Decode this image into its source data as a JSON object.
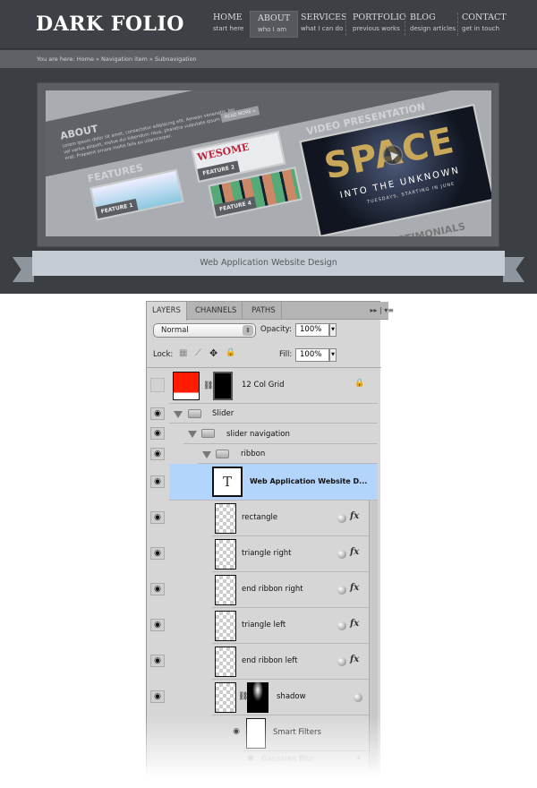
{
  "site": {
    "logo": "DARK FOLIO",
    "nav": [
      {
        "title": "HOME",
        "sub": "start here",
        "active": false
      },
      {
        "title": "ABOUT",
        "sub": "who I am",
        "active": true
      },
      {
        "title": "SERVICES",
        "sub": "what I can do",
        "active": false
      },
      {
        "title": "PORTFOLIO",
        "sub": "previous works",
        "active": false
      },
      {
        "title": "BLOG",
        "sub": "design articles",
        "active": false
      },
      {
        "title": "CONTACT",
        "sub": "get in touch",
        "active": false
      }
    ],
    "breadcrumb": "You are here: Home » Navigation item » Subnavigation",
    "hero": {
      "about_heading": "ABOUT",
      "about_text": "Lorem ipsum dolor sit amet, consectetur adipiscing elit. Aenean venenatis, leo vel varius aliquet, metus dui bibendum risus, pharetra vulputate ipsum orci at erat. Praesent ornare mollis felis eu ullamcorper.",
      "read_more": "READ MORE »",
      "features_heading": "FEATURES",
      "feature1": "FEATURE 1",
      "feature2": "FEATURE 2",
      "feature4": "FEATURE 4",
      "wesome": "WESOME",
      "video_heading": "VIDEO PRESENTATION",
      "video_title": "SPACE",
      "video_sub": "INTO THE UNKNOWN",
      "video_sub2": "TUESDAYS, STARTING IN JUNE",
      "testimonials": "TESTIMONIALS"
    },
    "ribbon": "Web Application Website Design"
  },
  "panel": {
    "tabs": [
      "LAYERS",
      "CHANNELS",
      "PATHS"
    ],
    "active_tab": "LAYERS",
    "blend_mode": "Normal",
    "opacity_label": "Opacity:",
    "opacity": "100%",
    "lock_label": "Lock:",
    "fill_label": "Fill:",
    "fill": "100%",
    "layers": [
      {
        "name": "12 Col Grid",
        "visible": false,
        "locked": true
      },
      {
        "name": "Slider",
        "type": "group",
        "visible": true
      },
      {
        "name": "slider navigation",
        "type": "group",
        "visible": true
      },
      {
        "name": "ribbon",
        "type": "group",
        "visible": true
      },
      {
        "name": "Web Application Website D...",
        "type": "text",
        "visible": true,
        "selected": true
      },
      {
        "name": "rectangle",
        "visible": true,
        "fx": true
      },
      {
        "name": "triangle right",
        "visible": true,
        "fx": true
      },
      {
        "name": "end ribbon right",
        "visible": true,
        "fx": true
      },
      {
        "name": "triangle left",
        "visible": true,
        "fx": true
      },
      {
        "name": "end ribbon left",
        "visible": true,
        "fx": true
      },
      {
        "name": "shadow",
        "visible": true
      },
      {
        "name": "Smart Filters",
        "visible": true
      },
      {
        "name": "Gaussian Blur",
        "visible": true
      }
    ],
    "fx_label": "fx",
    "colors": {
      "selected_row": "#b3d4fb",
      "grid_thumb": "#ff1a00"
    }
  }
}
